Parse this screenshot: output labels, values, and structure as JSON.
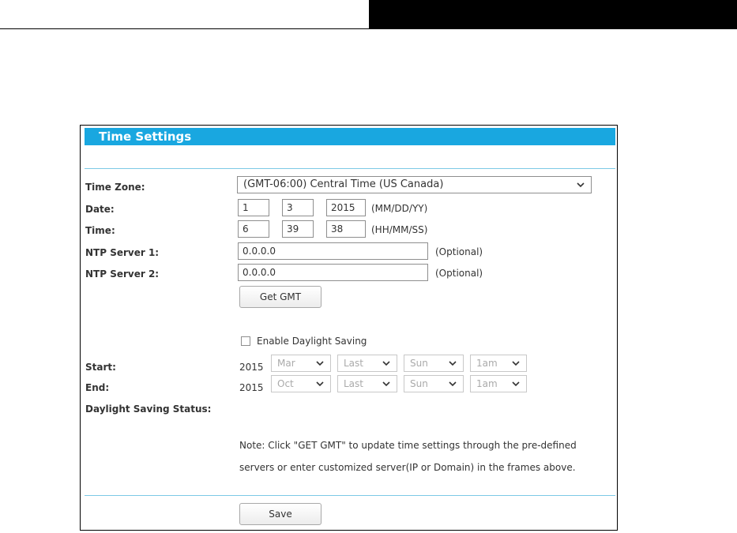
{
  "panel": {
    "title": "Time Settings"
  },
  "time_zone": {
    "label": "Time Zone:",
    "value": "(GMT-06:00) Central Time (US Canada)"
  },
  "date": {
    "label": "Date:",
    "month": "1",
    "day": "3",
    "year": "2015",
    "hint": "(MM/DD/YY)"
  },
  "time": {
    "label": "Time:",
    "hour": "6",
    "minute": "39",
    "second": "38",
    "hint": "(HH/MM/SS)"
  },
  "ntp1": {
    "label": "NTP Server 1:",
    "value": "0.0.0.0",
    "hint": "(Optional)"
  },
  "ntp2": {
    "label": "NTP Server 2:",
    "value": "0.0.0.0",
    "hint": "(Optional)"
  },
  "get_gmt_label": "Get GMT",
  "daylight": {
    "checkbox_label": "Enable Daylight Saving",
    "checked": false,
    "start": {
      "label": "Start:",
      "year": "2015",
      "month": "Mar",
      "week": "Last",
      "day": "Sun",
      "time": "1am"
    },
    "end": {
      "label": "End:",
      "year": "2015",
      "month": "Oct",
      "week": "Last",
      "day": "Sun",
      "time": "1am"
    },
    "status_label": "Daylight Saving Status:"
  },
  "note": {
    "line1": "Note: Click \"GET GMT\" to update time settings through the pre-defined",
    "line2": "servers or enter customized server(IP or Domain) in the frames above."
  },
  "save_label": "Save",
  "colors": {
    "header": "#19a7e0",
    "rule": "#7cc9e6"
  }
}
